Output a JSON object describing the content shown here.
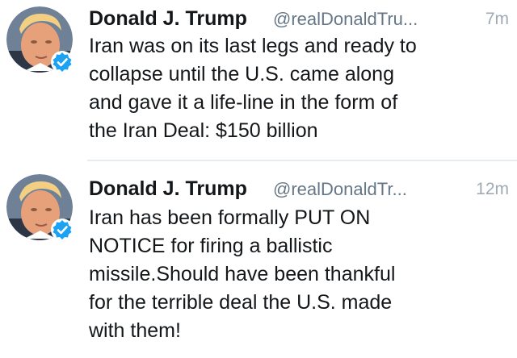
{
  "tweets": [
    {
      "name": "Donald J. Trump",
      "handle": "@realDonaldTru...",
      "time": "7m",
      "text": "Iran was on its last legs and ready to\ncollapse until the U.S. came along\nand gave it a life-line in the form of\nthe Iran Deal: $150 billion"
    },
    {
      "name": "Donald J. Trump",
      "handle": "@realDonaldTr...",
      "time": "12m",
      "text": "Iran has been formally PUT ON\nNOTICE for firing a ballistic\nmissile.Should have been thankful\nfor the terrible deal the U.S. made\nwith them!"
    }
  ],
  "colors": {
    "verified_badge": "#1da1f2",
    "name_text": "#14171a",
    "handle_text": "#657786",
    "time_text": "#a0aab4"
  }
}
